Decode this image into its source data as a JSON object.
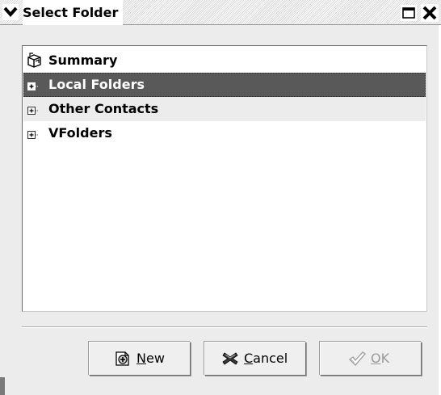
{
  "window": {
    "title": "Select Folder",
    "icons": {
      "menu": "window-menu-chevron-icon",
      "maximize": "maximize-icon",
      "close": "close-icon"
    }
  },
  "tree": {
    "items": [
      {
        "label": "Summary",
        "icon": "summary-folder-icon",
        "expandable": false,
        "selected": false
      },
      {
        "label": "Local Folders",
        "icon": "expander-plus-icon",
        "expandable": true,
        "selected": true
      },
      {
        "label": "Other Contacts",
        "icon": "expander-plus-icon",
        "expandable": true,
        "selected": false
      },
      {
        "label": "VFolders",
        "icon": "expander-plus-icon",
        "expandable": true,
        "selected": false
      }
    ]
  },
  "buttons": {
    "new": {
      "mnemonic": "N",
      "rest": "ew",
      "icon": "new-folder-icon",
      "enabled": true
    },
    "cancel": {
      "mnemonic": "C",
      "rest": "ancel",
      "icon": "cancel-x-icon",
      "enabled": true
    },
    "ok": {
      "mnemonic": "O",
      "rest": "K",
      "icon": "ok-checkmark-icon",
      "enabled": false
    }
  },
  "colors": {
    "selected_row": "#595959",
    "alt_row": "#ececec",
    "disabled_text": "#9a9a9a"
  }
}
